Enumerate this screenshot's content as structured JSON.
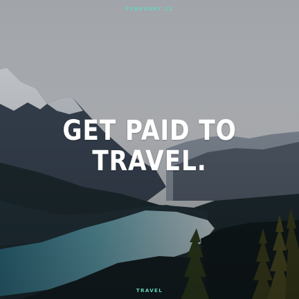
{
  "post": {
    "date": "FEBRUARY 22",
    "headline_line1": "GET PAID TO",
    "headline_line2": "TRAVEL.",
    "category": "TRAVEL"
  },
  "colors": {
    "accent": "#67d4bc",
    "headline": "#ffffff",
    "sky": "#c6c9cd",
    "lake": "#3e7f92"
  }
}
